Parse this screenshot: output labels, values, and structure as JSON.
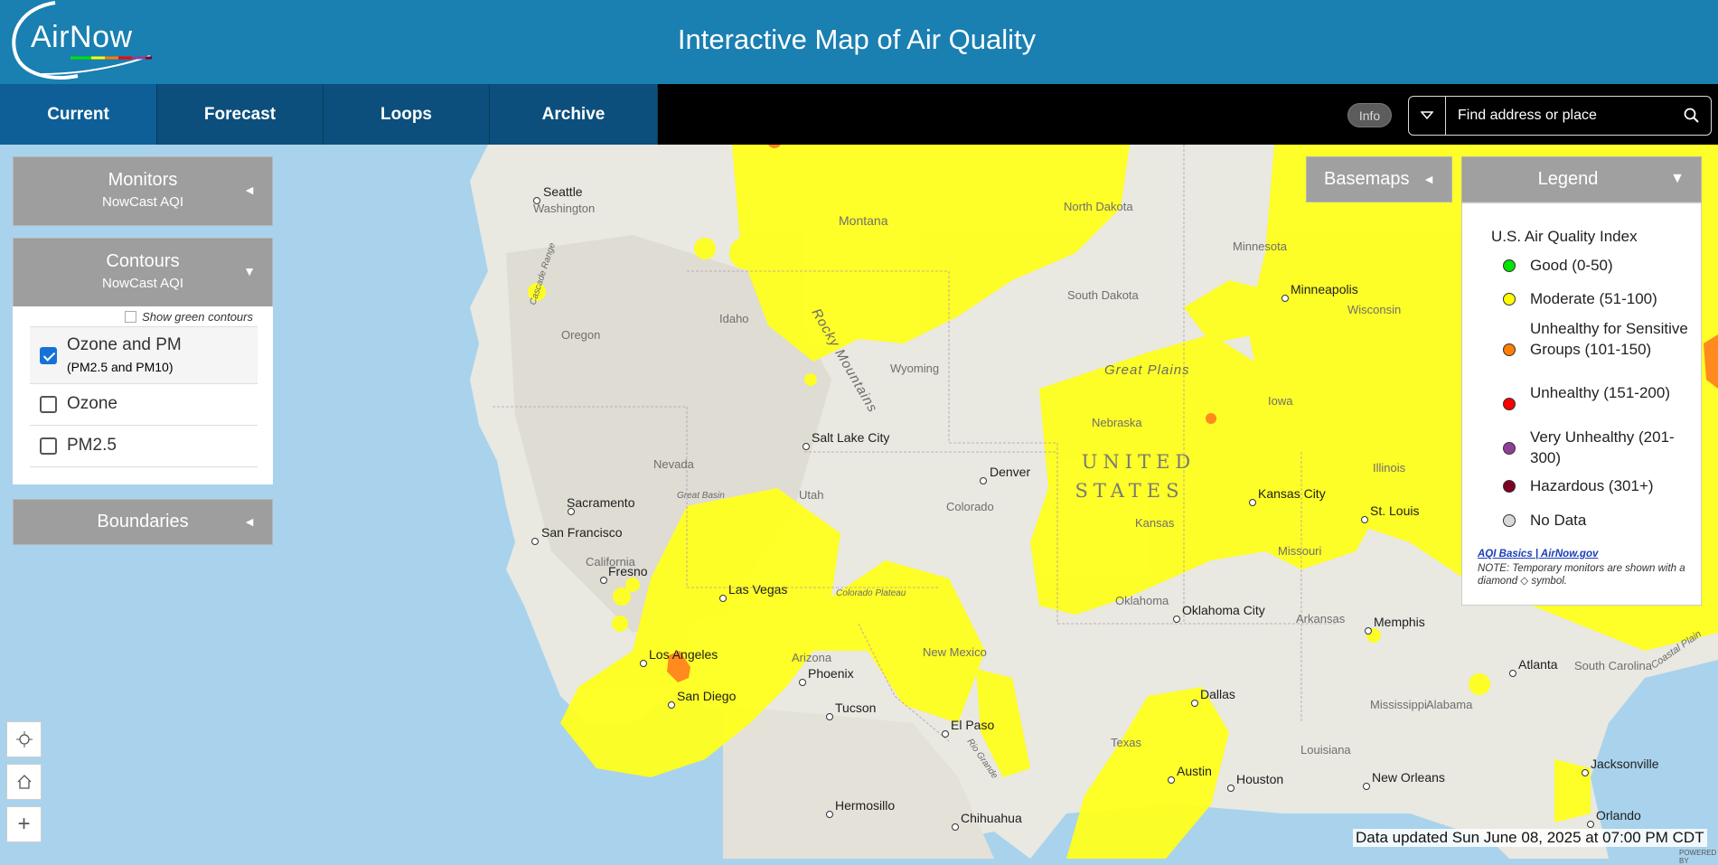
{
  "header": {
    "logo_text": "AirNow",
    "title": "Interactive Map of Air Quality"
  },
  "nav": {
    "tabs": [
      "Current",
      "Forecast",
      "Loops",
      "Archive"
    ],
    "active": "Current"
  },
  "toolbar": {
    "info_label": "Info",
    "search_placeholder": "Find address or place"
  },
  "monitors": {
    "title": "Monitors",
    "subtitle": "NowCast AQI",
    "arrow": "◄"
  },
  "contours": {
    "title": "Contours",
    "subtitle": "NowCast AQI",
    "arrow": "▼",
    "show_green_label": "Show green contours",
    "show_green_checked": false,
    "options": [
      {
        "label": "Ozone and PM",
        "sublabel": "(PM2.5 and PM10)",
        "checked": true
      },
      {
        "label": "Ozone",
        "checked": false
      },
      {
        "label": "PM2.5",
        "checked": false
      }
    ]
  },
  "boundaries": {
    "title": "Boundaries",
    "arrow": "◄"
  },
  "basemaps": {
    "title": "Basemaps",
    "arrow": "◄"
  },
  "legend": {
    "title": "Legend",
    "arrow": "▼",
    "aqi_title": "U.S. Air Quality Index",
    "items": [
      {
        "label": "Good (0-50)",
        "color": "#00e400"
      },
      {
        "label": "Moderate (51-100)",
        "color": "#ffff00"
      },
      {
        "label": "Unhealthy for Sensitive Groups (101-150)",
        "color": "#ff7e00"
      },
      {
        "label": "Unhealthy (151-200)",
        "color": "#ff0000"
      },
      {
        "label": "Very Unhealthy (201-300)",
        "color": "#8f3f97"
      },
      {
        "label": "Hazardous (301+)",
        "color": "#7e0023"
      },
      {
        "label": "No Data",
        "color": "#d9d9d9"
      }
    ],
    "link_text": "AQI Basics | AirNow.gov",
    "note": "NOTE: Temporary monitors are shown with a diamond ◇ symbol."
  },
  "map": {
    "cities": [
      "Seattle",
      "Minneapolis",
      "Salt Lake City",
      "Denver",
      "Sacramento",
      "San Francisco",
      "Fresno",
      "Las Vegas",
      "Los Angeles",
      "San Diego",
      "Phoenix",
      "Tucson",
      "El Paso",
      "Kansas City",
      "St. Louis",
      "Oklahoma City",
      "Memphis",
      "Atlanta",
      "Dallas",
      "Austin",
      "Houston",
      "New Orleans",
      "Jacksonville",
      "Orlando",
      "Hermosillo",
      "Chihuahua"
    ],
    "regions": [
      "Washington",
      "Oregon",
      "Idaho",
      "Montana",
      "Wyoming",
      "Nevada",
      "Utah",
      "Colorado",
      "California",
      "Arizona",
      "New Mexico",
      "North Dakota",
      "South Dakota",
      "Nebraska",
      "Kansas",
      "Oklahoma",
      "Texas",
      "Minnesota",
      "Iowa",
      "Wisconsin",
      "Illinois",
      "Missouri",
      "Arkansas",
      "Louisiana",
      "Mississippi",
      "Alabama",
      "South Carolina"
    ],
    "features": [
      "Rocky Mountains",
      "Great Plains",
      "Cascade Range",
      "Great Basin",
      "Colorado Plateau",
      "Rio Grande",
      "Coastal Plain"
    ],
    "country_line1": "UNITED",
    "country_line2": "STATES"
  },
  "status": {
    "updated": "Data updated Sun June 08, 2025 at 07:00 PM CDT",
    "powered_by": "POWERED BY"
  },
  "controls": {
    "locate": "locate-icon",
    "home": "home-icon",
    "zoom_in": "+"
  }
}
